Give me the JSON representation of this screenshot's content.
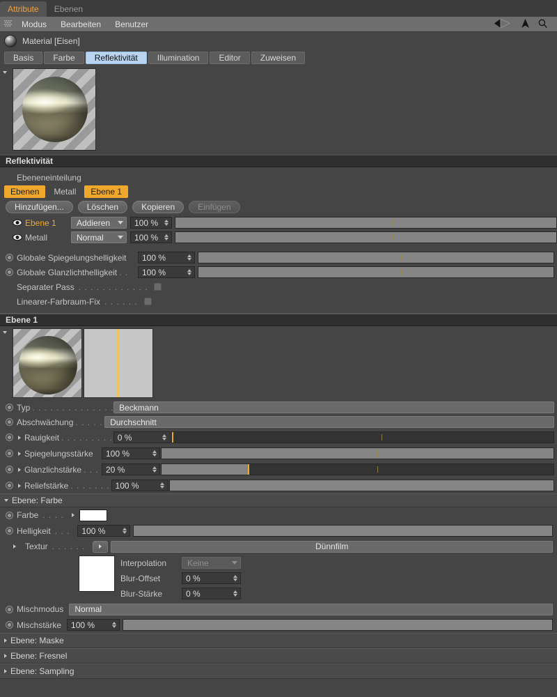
{
  "window": {
    "tabs": [
      {
        "label": "Attribute",
        "active": true
      },
      {
        "label": "Ebenen",
        "active": false
      }
    ]
  },
  "menubar": {
    "grip_icon": "grip-dots-icon",
    "items": [
      "Modus",
      "Bearbeiten",
      "Benutzer"
    ],
    "right_icons": [
      "back-arrow-icon",
      "up-arrow-icon",
      "search-icon"
    ]
  },
  "object": {
    "icon": "material-sphere-icon",
    "title": "Material [Eisen]"
  },
  "property_tabs": [
    {
      "label": "Basis",
      "selected": false
    },
    {
      "label": "Farbe",
      "selected": false
    },
    {
      "label": "Reflektivität",
      "selected": true
    },
    {
      "label": "Illumination",
      "selected": false
    },
    {
      "label": "Editor",
      "selected": false
    },
    {
      "label": "Zuweisen",
      "selected": false
    }
  ],
  "reflectivity": {
    "header": "Reflektivität",
    "layering_label": "Ebeneneinteilung",
    "chips": [
      {
        "label": "Ebenen",
        "on": true
      },
      {
        "label": "Metall",
        "on": false
      },
      {
        "label": "Ebene 1",
        "on": true
      }
    ],
    "buttons": [
      {
        "label": "Hinzufügen...",
        "disabled": false
      },
      {
        "label": "Löschen",
        "disabled": false
      },
      {
        "label": "Kopieren",
        "disabled": false
      },
      {
        "label": "Einfügen",
        "disabled": true
      }
    ],
    "layers": [
      {
        "name": "Ebene 1",
        "highlight": true,
        "mode": "Addieren",
        "opacity": "100 %",
        "opacity_pct": 100
      },
      {
        "name": "Metall",
        "highlight": false,
        "mode": "Normal",
        "opacity": "100 %",
        "opacity_pct": 100
      }
    ],
    "globals": [
      {
        "label": "Globale Spiegelungshelligkeit",
        "value": "100 %",
        "pct": 100,
        "dots": ""
      },
      {
        "label": "Globale Glanzlichthelligkeit",
        "value": "100 %",
        "pct": 100,
        "dots": ". ."
      }
    ],
    "checks": [
      {
        "label": "Separater Pass",
        "dots": ". . . . . . . . . . . .",
        "checked": false
      },
      {
        "label": "Linearer-Farbraum-Fix",
        "dots": ". . . . . .",
        "checked": false
      }
    ]
  },
  "layer": {
    "header": "Ebene 1",
    "preview_icon": "material-sphere-preview",
    "curve_icon": "reflection-curve-preview",
    "params": [
      {
        "label": "Typ",
        "dots": ". . . . . . . . . . . . . .",
        "type": "flat",
        "value": "Beckmann",
        "sub": false
      },
      {
        "label": "Abschwächung",
        "dots": ". . . . .",
        "type": "flat",
        "value": "Durchschnitt",
        "sub": false
      },
      {
        "label": "Rauigkeit",
        "dots": ". . . . . . . . .",
        "type": "slider",
        "value": "0 %",
        "pct": 0,
        "sub": true
      },
      {
        "label": "Spiegelungsstärke",
        "dots": "",
        "type": "slider",
        "value": "100 %",
        "pct": 100,
        "sub": true
      },
      {
        "label": "Glanzlichstärke",
        "dots": ". . .",
        "type": "slider",
        "value": "20 %",
        "pct": 22,
        "sub": true
      },
      {
        "label": "Reliefstärke",
        "dots": ". . . . . . .",
        "type": "slider",
        "value": "100 %",
        "pct": 100,
        "sub": true
      }
    ]
  },
  "layer_color": {
    "header": "Ebene: Farbe",
    "color_label": "Farbe",
    "color_dots": ". . . .",
    "color_value": "#ffffff",
    "brightness_label": "Helligkeit",
    "brightness_dots": ". . .",
    "brightness_value": "100 %",
    "brightness_pct": 100,
    "texture_label": "Textur",
    "texture_dots": ". . . . . .",
    "texture_value": "Dünnfilm",
    "texture_swatch": "#ffffff",
    "interpolation_label": "Interpolation",
    "interpolation_value": "Keine",
    "blur_offset_label": "Blur-Offset",
    "blur_offset_value": "0 %",
    "blur_strength_label": "Blur-Stärke",
    "blur_strength_value": "0 %",
    "mix_mode_label": "Mischmodus",
    "mix_mode_value": "Normal",
    "mix_strength_label": "Mischstärke",
    "mix_strength_value": "100 %",
    "mix_strength_pct": 100
  },
  "collapsed_sections": [
    {
      "label": "Ebene: Maske"
    },
    {
      "label": "Ebene: Fresnel"
    },
    {
      "label": "Ebene: Sampling"
    }
  ],
  "colors": {
    "accent_orange": "#f0a82c",
    "tab_selected_blue": "#b8d4f0",
    "panel_bg": "#454545",
    "header_bg": "#2f2f2f"
  }
}
